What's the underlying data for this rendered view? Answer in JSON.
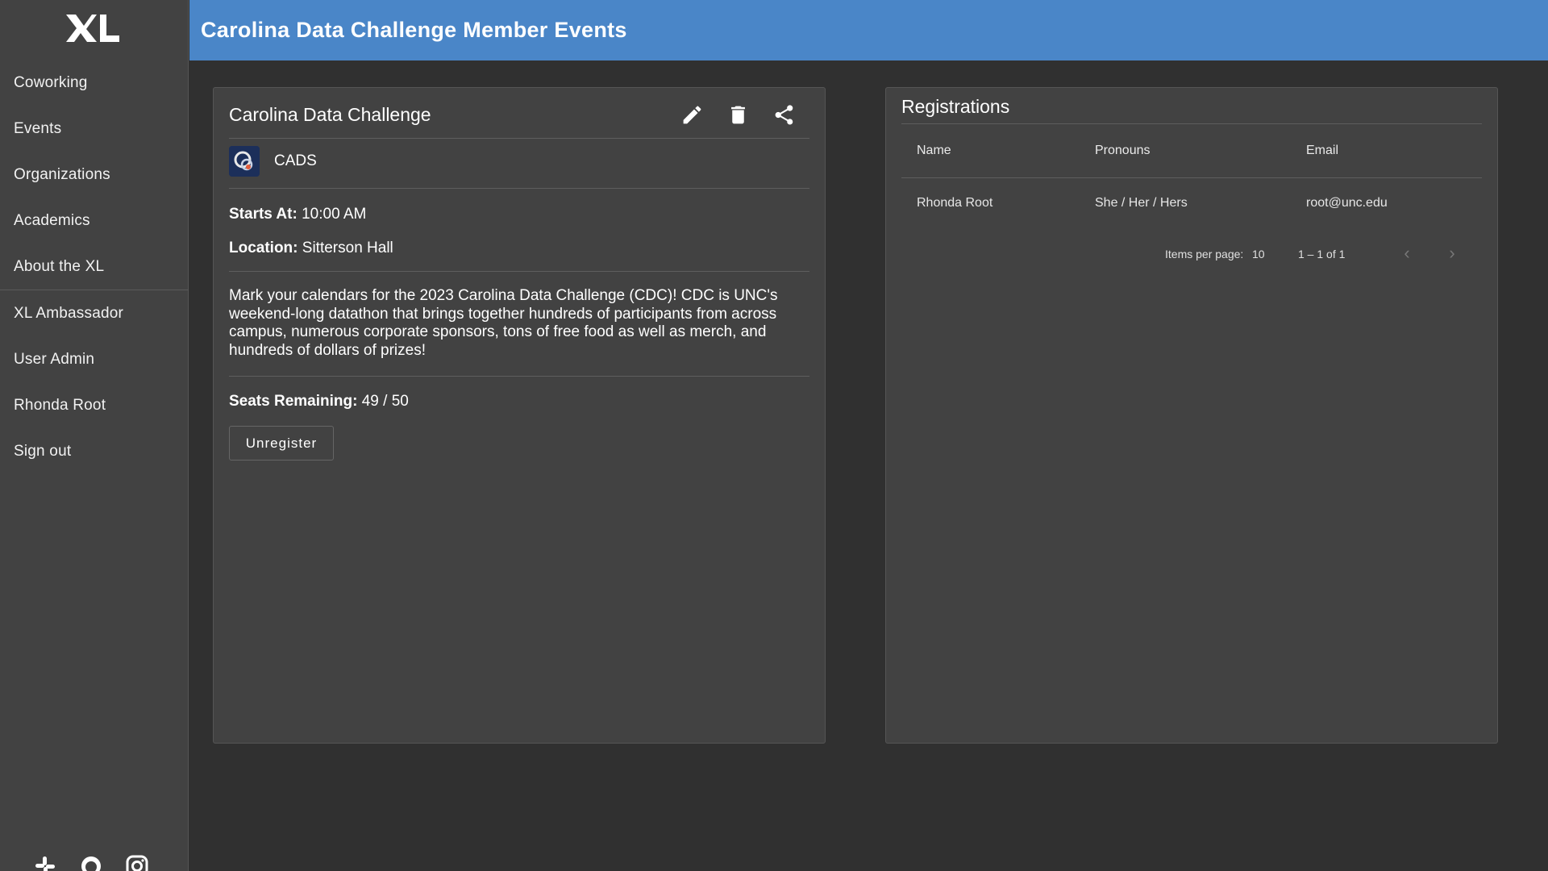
{
  "sidebar": {
    "logo_text": "XL",
    "items": [
      {
        "label": "Coworking"
      },
      {
        "label": "Events"
      },
      {
        "label": "Organizations"
      },
      {
        "label": "Academics"
      },
      {
        "label": "About the XL"
      },
      {
        "label": "XL Ambassador"
      },
      {
        "label": "User Admin"
      },
      {
        "label": "Rhonda Root"
      },
      {
        "label": "Sign out"
      }
    ],
    "social_icons": [
      "slack-icon",
      "github-icon",
      "instagram-icon"
    ]
  },
  "header": {
    "title": "Carolina Data Challenge Member Events",
    "color": "#4a86c8"
  },
  "event": {
    "title": "Carolina Data Challenge",
    "organization": "CADS",
    "starts_label": "Starts At:",
    "starts_value": "10:00 AM",
    "location_label": "Location:",
    "location_value": "Sitterson Hall",
    "description": "Mark your calendars for the 2023 Carolina Data Challenge (CDC)! CDC is UNC's weekend-long datathon that brings together hundreds of participants from across campus, numerous corporate sponsors, tons of free food as well as merch, and hundreds of dollars of prizes!",
    "seats_label": "Seats Remaining:",
    "seats_value": "49 / 50",
    "unregister_label": "Unregister",
    "action_icons": [
      "edit-icon",
      "delete-icon",
      "share-icon"
    ]
  },
  "registrations": {
    "title": "Registrations",
    "columns": [
      "Name",
      "Pronouns",
      "Email"
    ],
    "rows": [
      {
        "name": "Rhonda Root",
        "pronouns": "She / Her / Hers",
        "email": "root@unc.edu"
      }
    ],
    "paginator": {
      "items_per_page_label": "Items per page:",
      "items_per_page": "10",
      "range": "1 – 1 of 1"
    }
  }
}
